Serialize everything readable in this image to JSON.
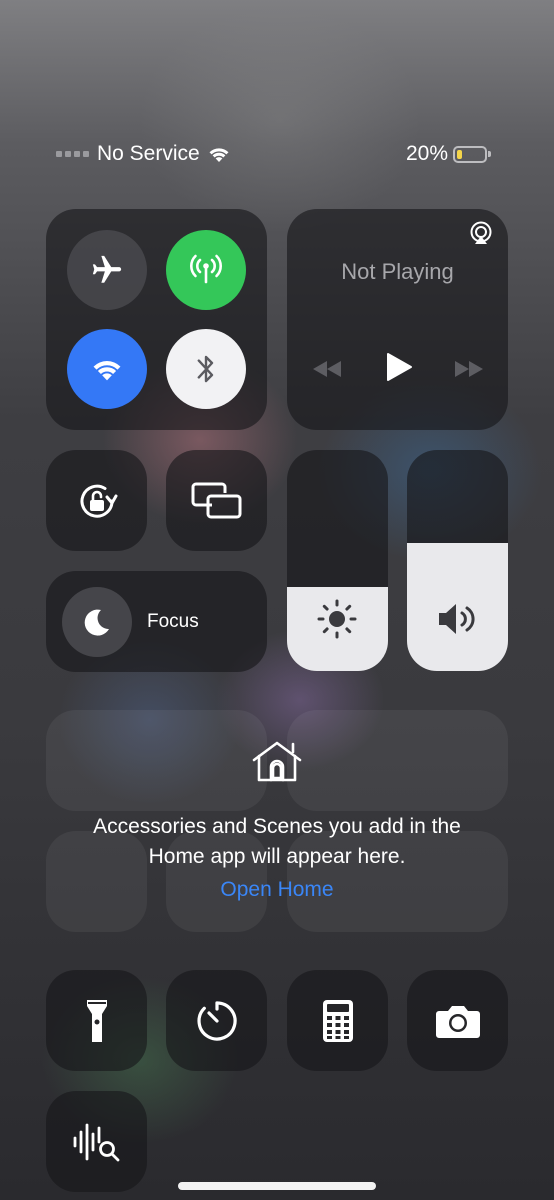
{
  "status_bar": {
    "carrier": "No Service",
    "battery_percent": "20%",
    "battery_level": 0.2
  },
  "connectivity": {
    "airplane": {
      "icon": "airplane-icon",
      "active": false
    },
    "cellular": {
      "icon": "antenna-icon",
      "active": true,
      "color": "#34c759"
    },
    "wifi": {
      "icon": "wifi-icon",
      "active": true,
      "color": "#3478f6"
    },
    "bluetooth": {
      "icon": "bluetooth-icon",
      "active": false
    }
  },
  "now_playing": {
    "title": "Not Playing"
  },
  "focus": {
    "label": "Focus"
  },
  "sliders": {
    "brightness": {
      "level": 0.38
    },
    "volume": {
      "level": 0.58
    }
  },
  "home": {
    "message": "Accessories and Scenes you add in the Home app will appear here.",
    "link": "Open Home",
    "link_color": "#3478f6"
  },
  "bottom_controls": [
    "flashlight-icon",
    "timer-icon",
    "calculator-icon",
    "camera-icon",
    "sound-recognition-icon"
  ]
}
